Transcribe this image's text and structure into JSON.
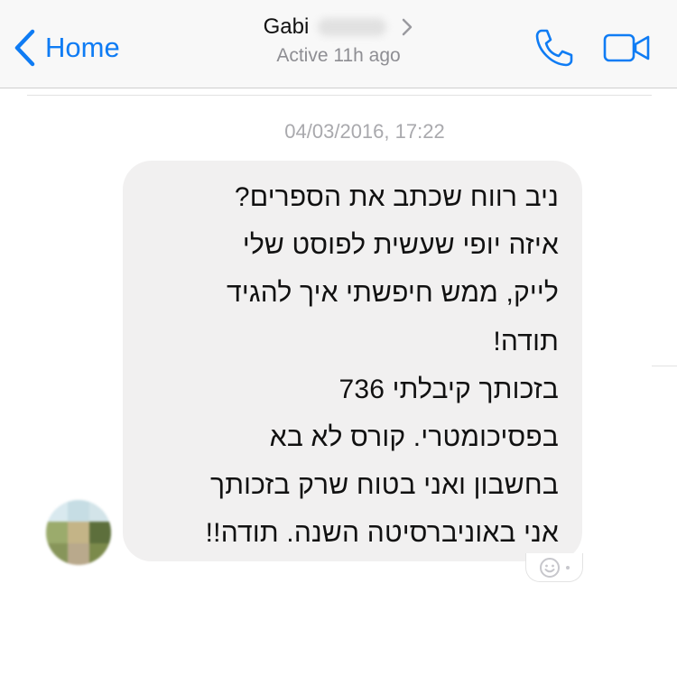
{
  "header": {
    "back_label": "Home",
    "contact_name": "Gabi",
    "status": "Active 11h ago"
  },
  "conversation": {
    "timestamp": "04/03/2016, 17:22",
    "message_lines": [
      "ניב רווח שכתב את הספרים?",
      "איזה יופי שעשית לפוסט שלי",
      "לייק, ממש חיפשתי איך להגיד",
      "תודה!",
      "בזכותך קיבלתי 736",
      "בפסיכומטרי. קורס לא בא",
      "בחשבון ואני בטוח שרק בזכותך",
      "אני באוניברסיטה השנה. תודה!!"
    ]
  },
  "icons": {
    "back": "chevron-left-icon",
    "profile": "chevron-right-icon",
    "call": "phone-icon",
    "video": "video-camera-icon",
    "reaction": "smiley-icon"
  },
  "colors": {
    "accent": "#0f7cf4",
    "bubble": "#f1f0f0",
    "status_text": "#8e8e93",
    "timestamp_text": "#a9a9ad"
  }
}
